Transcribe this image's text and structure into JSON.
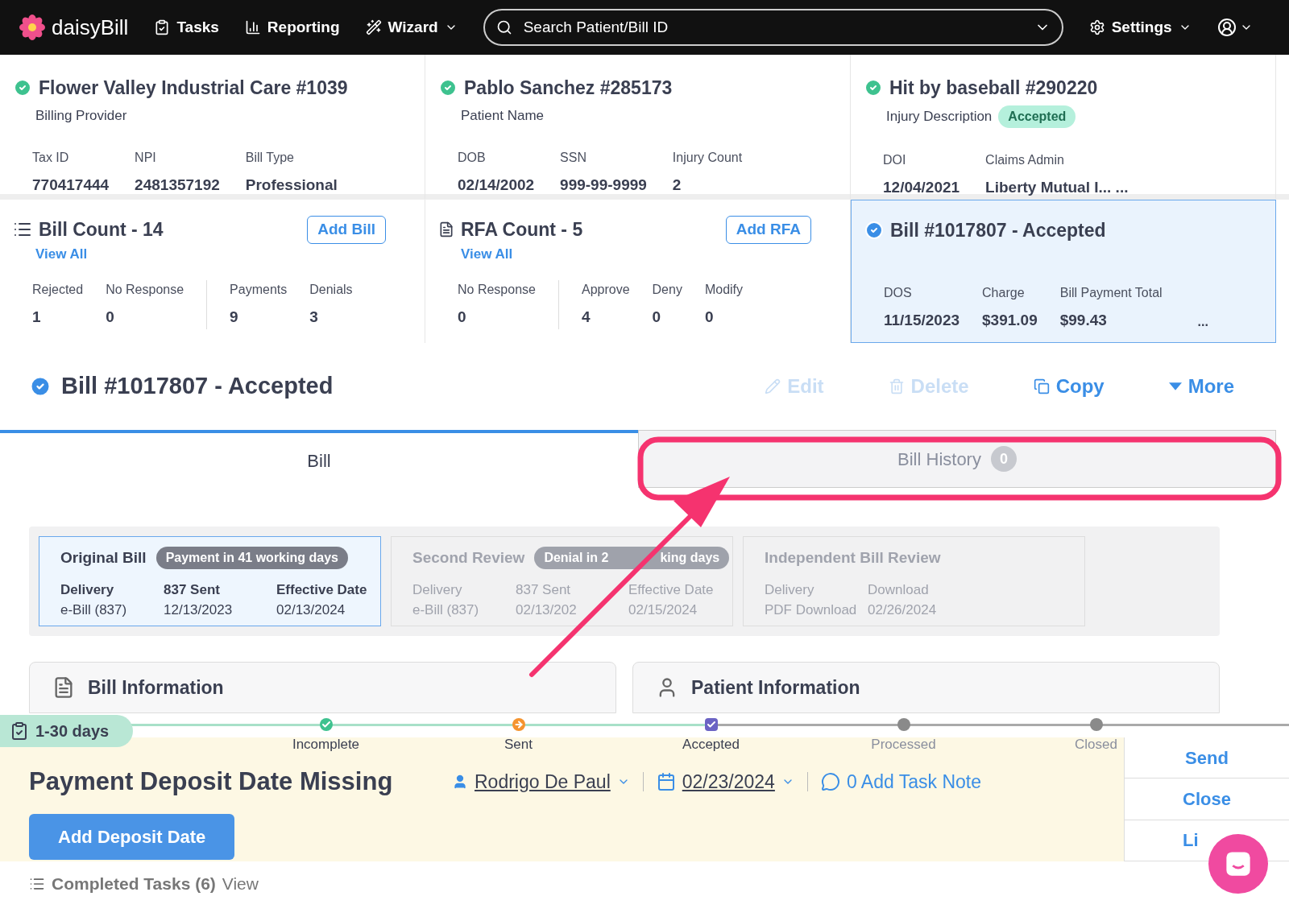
{
  "nav": {
    "brand": "daisyBill",
    "items": [
      {
        "label": "Tasks",
        "kind": "tasks"
      },
      {
        "label": "Reporting",
        "kind": "reporting"
      },
      {
        "label": "Wizard",
        "kind": "wizard"
      }
    ],
    "search": {
      "placeholder": "Search Patient/Bill ID"
    },
    "settings": "Settings"
  },
  "summary": [
    {
      "title": "Flower Valley Industrial Care #1039",
      "subtitle": "Billing Provider",
      "fields": [
        {
          "label": "Tax ID",
          "value": "770417444"
        },
        {
          "label": "NPI",
          "value": "2481357192"
        },
        {
          "label": "Bill Type",
          "value": "Professional"
        }
      ]
    },
    {
      "title": "Pablo Sanchez #285173",
      "subtitle": "Patient Name",
      "fields": [
        {
          "label": "DOB",
          "value": "02/14/2002"
        },
        {
          "label": "SSN",
          "value": "999-99-9999"
        },
        {
          "label": "Injury Count",
          "value": "2"
        }
      ]
    },
    {
      "title": "Hit by baseball #290220",
      "subtitle": "Injury Description",
      "badge": "Accepted",
      "fields": [
        {
          "label": "DOI",
          "value": "12/04/2021"
        },
        {
          "label": "Claims Admin",
          "value": "Liberty Mutual I... ..."
        }
      ]
    }
  ],
  "counts": [
    {
      "title": "Bill Count - 14",
      "kind": "list",
      "link": "View All",
      "button": "Add Bill",
      "groups": [
        [
          {
            "label": "Rejected",
            "value": "1"
          },
          {
            "label": "No Response",
            "value": "0"
          }
        ],
        [
          {
            "label": "Payments",
            "value": "9"
          },
          {
            "label": "Denials",
            "value": "3"
          }
        ]
      ]
    },
    {
      "title": "RFA Count - 5",
      "kind": "form",
      "link": "View All",
      "button": "Add RFA",
      "groups": [
        [
          {
            "label": "No Response",
            "value": "0"
          }
        ],
        [
          {
            "label": "Approve",
            "value": "4"
          },
          {
            "label": "Deny",
            "value": "0"
          },
          {
            "label": "Modify",
            "value": "0"
          }
        ]
      ]
    }
  ],
  "bill_card": {
    "title": "Bill #1017807 - Accepted",
    "fields": [
      {
        "label": "DOS",
        "value": "11/15/2023"
      },
      {
        "label": "Charge",
        "value": "$391.09"
      },
      {
        "label": "Bill Payment Total",
        "value": "$99.43"
      }
    ],
    "more": "..."
  },
  "bill_header": {
    "title": "Bill #1017807 - Accepted",
    "actions": [
      {
        "label": "Edit",
        "kind": "edit",
        "disabled": true
      },
      {
        "label": "Delete",
        "kind": "delete",
        "disabled": true
      },
      {
        "label": "Copy",
        "kind": "copy",
        "disabled": false
      },
      {
        "label": "More",
        "kind": "more",
        "disabled": false
      }
    ]
  },
  "tabs": [
    {
      "label": "Bill",
      "selected": true
    },
    {
      "label": "Bill History",
      "count": "0",
      "selected": false
    }
  ],
  "reviews": [
    {
      "title": "Original Bill",
      "badge": "Payment in 41 working days",
      "selected": true,
      "fields": [
        {
          "label": "Delivery",
          "value": "e-Bill (837)"
        },
        {
          "label": "837 Sent",
          "value": "12/13/2023"
        },
        {
          "label": "Effective Date",
          "value": "02/13/2024"
        }
      ]
    },
    {
      "title": "Second Review",
      "badge": "Denial in 2",
      "badge_tail": "king days",
      "selected": false,
      "fields": [
        {
          "label": "Delivery",
          "value": "e-Bill (837)"
        },
        {
          "label": "837 Sent",
          "value": "02/13/202"
        },
        {
          "label": "Effective Date",
          "value": "02/15/2024"
        }
      ]
    },
    {
      "title": "Independent Bill Review",
      "selected": false,
      "fields": [
        {
          "label": "Delivery",
          "value": "PDF Download"
        },
        {
          "label": "Download",
          "value": "02/26/2024"
        }
      ]
    }
  ],
  "sections": [
    {
      "title": "Bill Information",
      "kind": "bill"
    },
    {
      "title": "Patient Information",
      "kind": "patient"
    }
  ],
  "task": {
    "age": "1-30 days",
    "steps": [
      {
        "label": "Incomplete",
        "kind": "check",
        "color": "#3ec28f",
        "reached": true
      },
      {
        "label": "Sent",
        "kind": "arrow",
        "color": "#f5942f",
        "reached": true
      },
      {
        "label": "Accepted",
        "kind": "box",
        "color": "#6b63c4",
        "reached": true
      },
      {
        "label": "Processed",
        "kind": "dot",
        "color": "#8a8a8a",
        "reached": false
      },
      {
        "label": "Closed",
        "kind": "dot",
        "color": "#8a8a8a",
        "reached": false
      }
    ],
    "title": "Payment Deposit Date Missing",
    "assignee": "Rodrigo De Paul",
    "due": "02/23/2024",
    "note": "0 Add Task Note",
    "action": "Add Deposit Date",
    "side": [
      "Send",
      "Close",
      "Li"
    ]
  },
  "completed": {
    "label": "Completed Tasks (6)",
    "link": "View"
  }
}
